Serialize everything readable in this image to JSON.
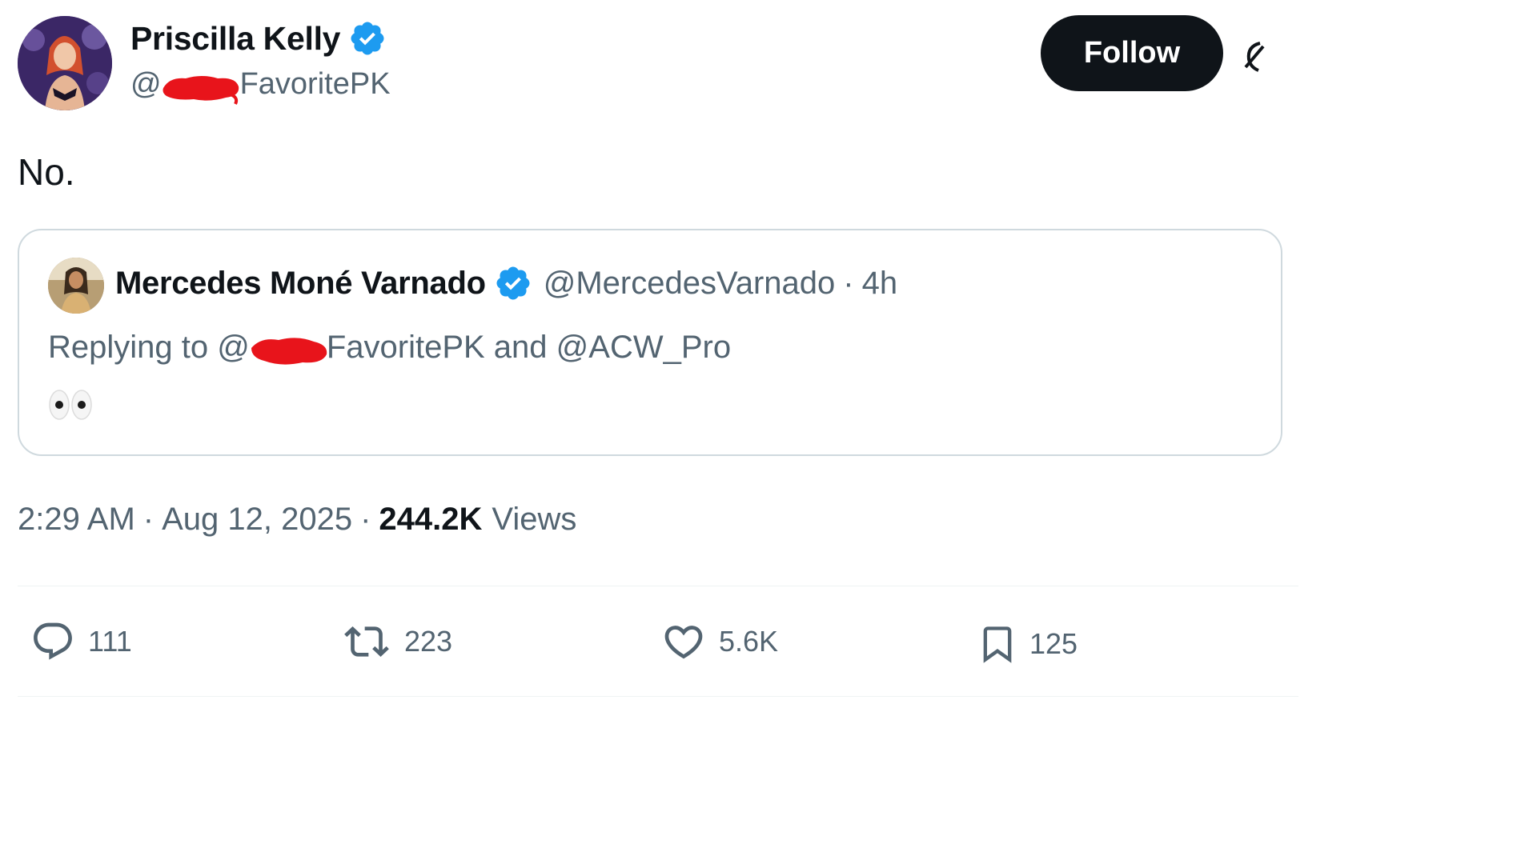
{
  "author": {
    "display_name": "Priscilla Kelly",
    "handle_prefix": "@",
    "handle_suffix": "FavoritePK",
    "verified": true
  },
  "follow_button": {
    "label": "Follow"
  },
  "tweet": {
    "text": "No.",
    "time": "2:29 AM",
    "date": "Aug 12, 2025",
    "views_count": "244.2K",
    "views_label": "Views"
  },
  "quoted_tweet": {
    "display_name": "Mercedes Moné Varnado",
    "handle": "@MercedesVarnado",
    "time_ago": "4h",
    "replying_prefix": "Replying to @",
    "replying_suffix": "FavoritePK and @ACW_Pro",
    "emoji_icon": "eyes-emoji-icon"
  },
  "actions": {
    "reply_count": "111",
    "retweet_count": "223",
    "like_count": "5.6K",
    "bookmark_count": "125"
  },
  "icons": {
    "verified": "verified-badge-icon",
    "reply": "reply-bubble-icon",
    "retweet": "retweet-icon",
    "like": "heart-icon",
    "bookmark": "bookmark-icon",
    "grok": "grok-icon"
  },
  "colors": {
    "verified_blue": "#1d9bf0",
    "text_primary": "#0f1419",
    "text_secondary": "#536471",
    "border": "#cfd9de",
    "follow_bg": "#0f1419",
    "redaction_red": "#e8141b"
  }
}
